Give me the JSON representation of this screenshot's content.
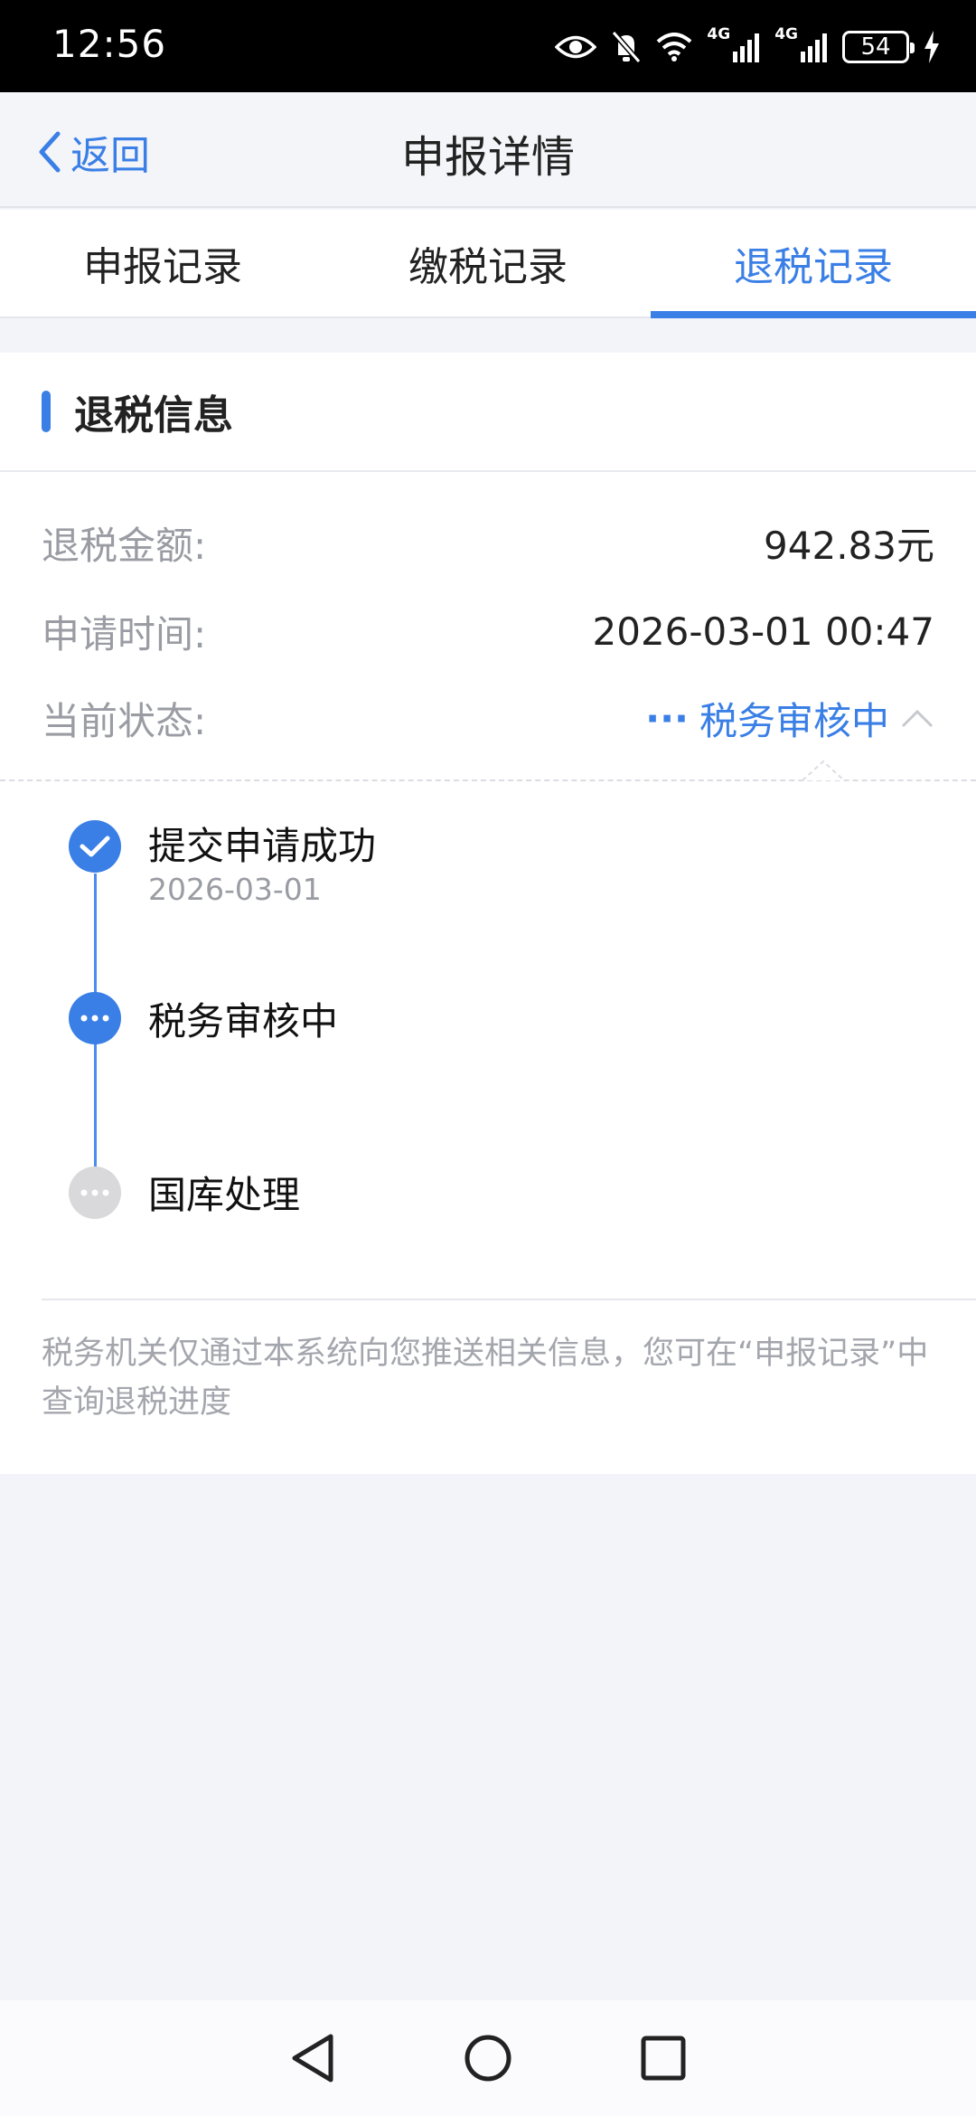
{
  "status_bar": {
    "time": "12:56",
    "battery": "54",
    "signal1": "4G",
    "signal2": "4G",
    "icons": [
      "eye-icon",
      "bell-off-icon",
      "wifi-icon",
      "signal-icon",
      "signal-icon",
      "battery-icon",
      "charging-icon"
    ]
  },
  "header": {
    "back_label": "返回",
    "title": "申报详情"
  },
  "tabs": [
    {
      "label": "申报记录",
      "active": false
    },
    {
      "label": "缴税记录",
      "active": false
    },
    {
      "label": "退税记录",
      "active": true
    }
  ],
  "refund": {
    "section_title": "退税信息",
    "amount_label": "退税金额:",
    "amount_value": "942.83元",
    "time_label": "申请时间:",
    "time_value": "2026-03-01 00:47",
    "status_label": "当前状态:",
    "status_dots": "···",
    "status_value": "税务审核中"
  },
  "timeline": [
    {
      "title": "提交申请成功",
      "date": "2026-03-01",
      "state": "done"
    },
    {
      "title": "税务审核中",
      "date": "",
      "state": "current"
    },
    {
      "title": "国库处理",
      "date": "",
      "state": "pending"
    }
  ],
  "note": "税务机关仅通过本系统向您推送相关信息，您可在“申报记录”中查询退税进度",
  "colors": {
    "accent": "#3a7fe6",
    "pending": "#d9d9db",
    "background": "#f3f4f9"
  }
}
